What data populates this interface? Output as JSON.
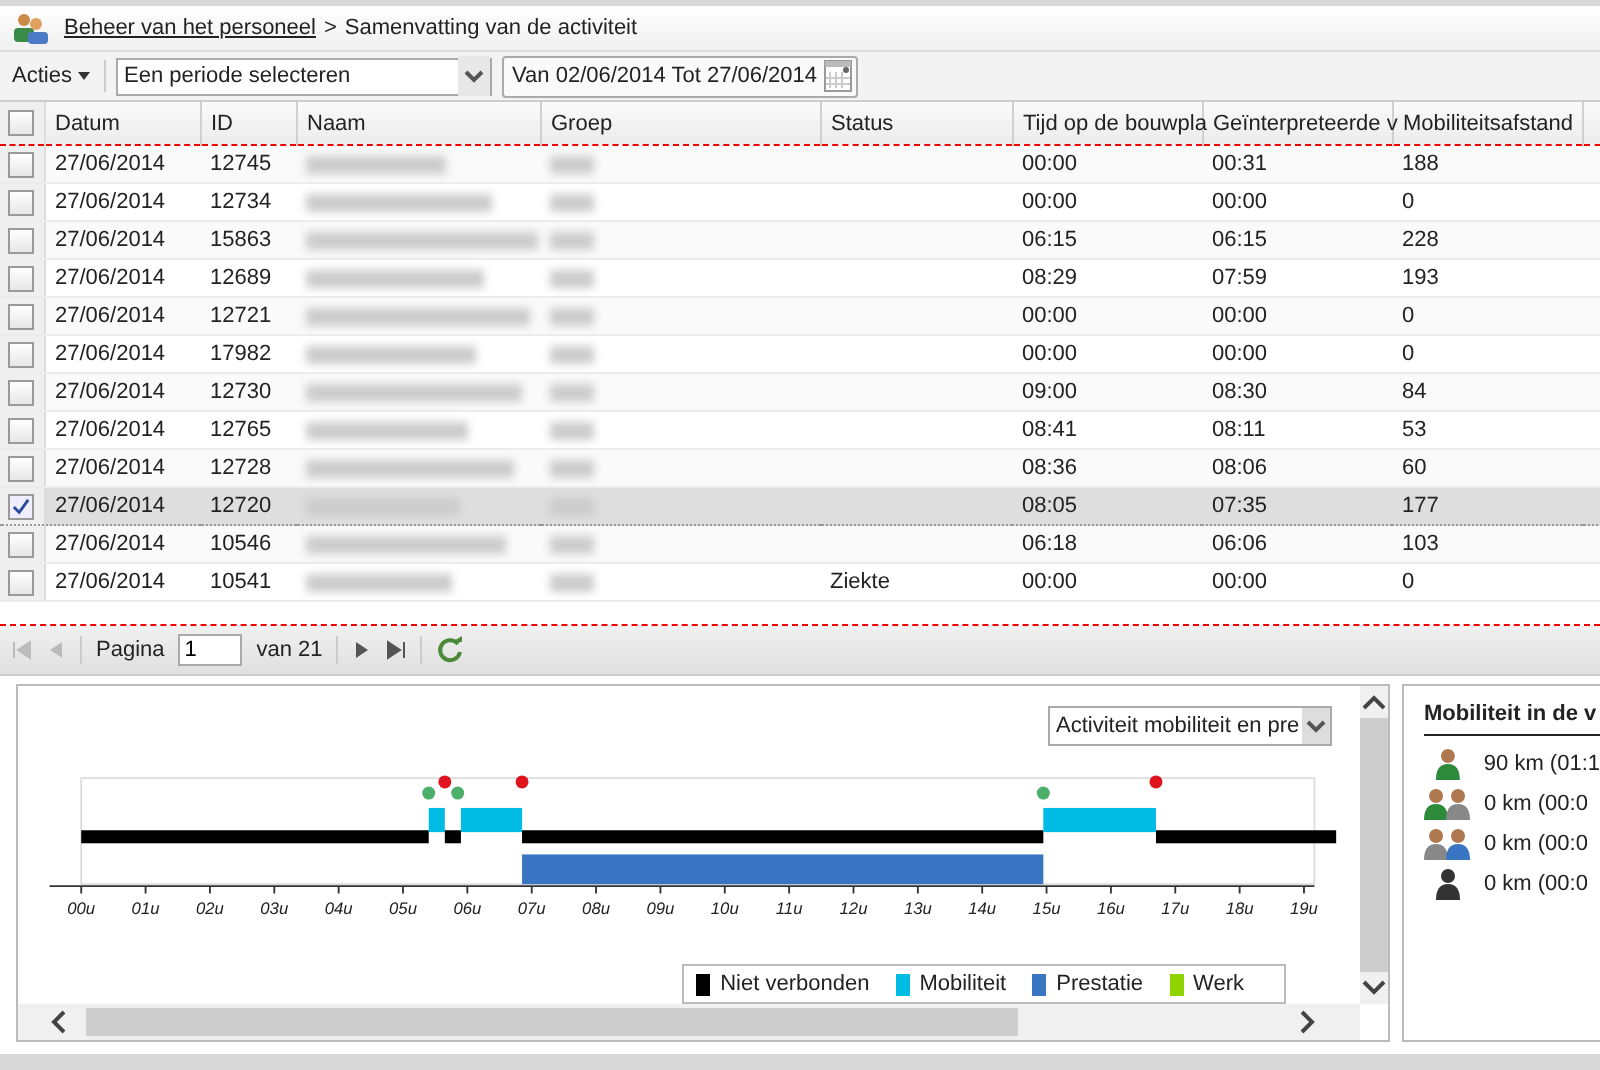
{
  "breadcrumb": {
    "link": "Beheer van het personeel",
    "separator": ">",
    "current": "Samenvatting van de activiteit"
  },
  "toolbar": {
    "actions": "Acties",
    "period_select": "Een periode selecteren",
    "date_range": "Van 02/06/2014 Tot 27/06/2014"
  },
  "table": {
    "select_all": false,
    "columns": [
      "Datum",
      "ID",
      "Naam",
      "Groep",
      "Status",
      "Tijd op de bouwpla",
      "Geïnterpreteerde v",
      "Mobiliteitsafstand"
    ],
    "rows": [
      {
        "selected": false,
        "date": "27/06/2014",
        "id": "12745",
        "status": "",
        "site_time": "00:00",
        "interpreted": "00:31",
        "distance": "188"
      },
      {
        "selected": false,
        "date": "27/06/2014",
        "id": "12734",
        "status": "",
        "site_time": "00:00",
        "interpreted": "00:00",
        "distance": "0"
      },
      {
        "selected": false,
        "date": "27/06/2014",
        "id": "15863",
        "status": "",
        "site_time": "06:15",
        "interpreted": "06:15",
        "distance": "228"
      },
      {
        "selected": false,
        "date": "27/06/2014",
        "id": "12689",
        "status": "",
        "site_time": "08:29",
        "interpreted": "07:59",
        "distance": "193"
      },
      {
        "selected": false,
        "date": "27/06/2014",
        "id": "12721",
        "status": "",
        "site_time": "00:00",
        "interpreted": "00:00",
        "distance": "0"
      },
      {
        "selected": false,
        "date": "27/06/2014",
        "id": "17982",
        "status": "",
        "site_time": "00:00",
        "interpreted": "00:00",
        "distance": "0"
      },
      {
        "selected": false,
        "date": "27/06/2014",
        "id": "12730",
        "status": "",
        "site_time": "09:00",
        "interpreted": "08:30",
        "distance": "84"
      },
      {
        "selected": false,
        "date": "27/06/2014",
        "id": "12765",
        "status": "",
        "site_time": "08:41",
        "interpreted": "08:11",
        "distance": "53"
      },
      {
        "selected": false,
        "date": "27/06/2014",
        "id": "12728",
        "status": "",
        "site_time": "08:36",
        "interpreted": "08:06",
        "distance": "60"
      },
      {
        "selected": true,
        "date": "27/06/2014",
        "id": "12720",
        "status": "",
        "site_time": "08:05",
        "interpreted": "07:35",
        "distance": "177"
      },
      {
        "selected": false,
        "date": "27/06/2014",
        "id": "10546",
        "status": "",
        "site_time": "06:18",
        "interpreted": "06:06",
        "distance": "103"
      },
      {
        "selected": false,
        "date": "27/06/2014",
        "id": "10541",
        "status": "Ziekte",
        "site_time": "00:00",
        "interpreted": "00:00",
        "distance": "0"
      }
    ]
  },
  "pager": {
    "label": "Pagina",
    "page": "1",
    "of": "van 21"
  },
  "timeline": {
    "view_select": "Activiteit mobiliteit en pre",
    "hours": [
      "00u",
      "01u",
      "02u",
      "03u",
      "04u",
      "05u",
      "06u",
      "07u",
      "08u",
      "09u",
      "10u",
      "11u",
      "12u",
      "13u",
      "14u",
      "15u",
      "16u",
      "17u",
      "18u",
      "19u"
    ],
    "legend": [
      {
        "label": "Niet verbonden",
        "color": "#000000"
      },
      {
        "label": "Mobiliteit",
        "color": "#00bce4"
      },
      {
        "label": "Prestatie",
        "color": "#3a75c4"
      },
      {
        "label": "Werk",
        "color": "#8fd400"
      }
    ]
  },
  "mobility": {
    "title": "Mobiliteit in de v",
    "entries": [
      {
        "kind": "driver",
        "text": "90 km (01:1"
      },
      {
        "kind": "driver-passenger",
        "text": "0 km (00:0"
      },
      {
        "kind": "passenger",
        "text": "0 km (00:0"
      },
      {
        "kind": "unknown",
        "text": "0 km (00:0"
      }
    ]
  }
}
